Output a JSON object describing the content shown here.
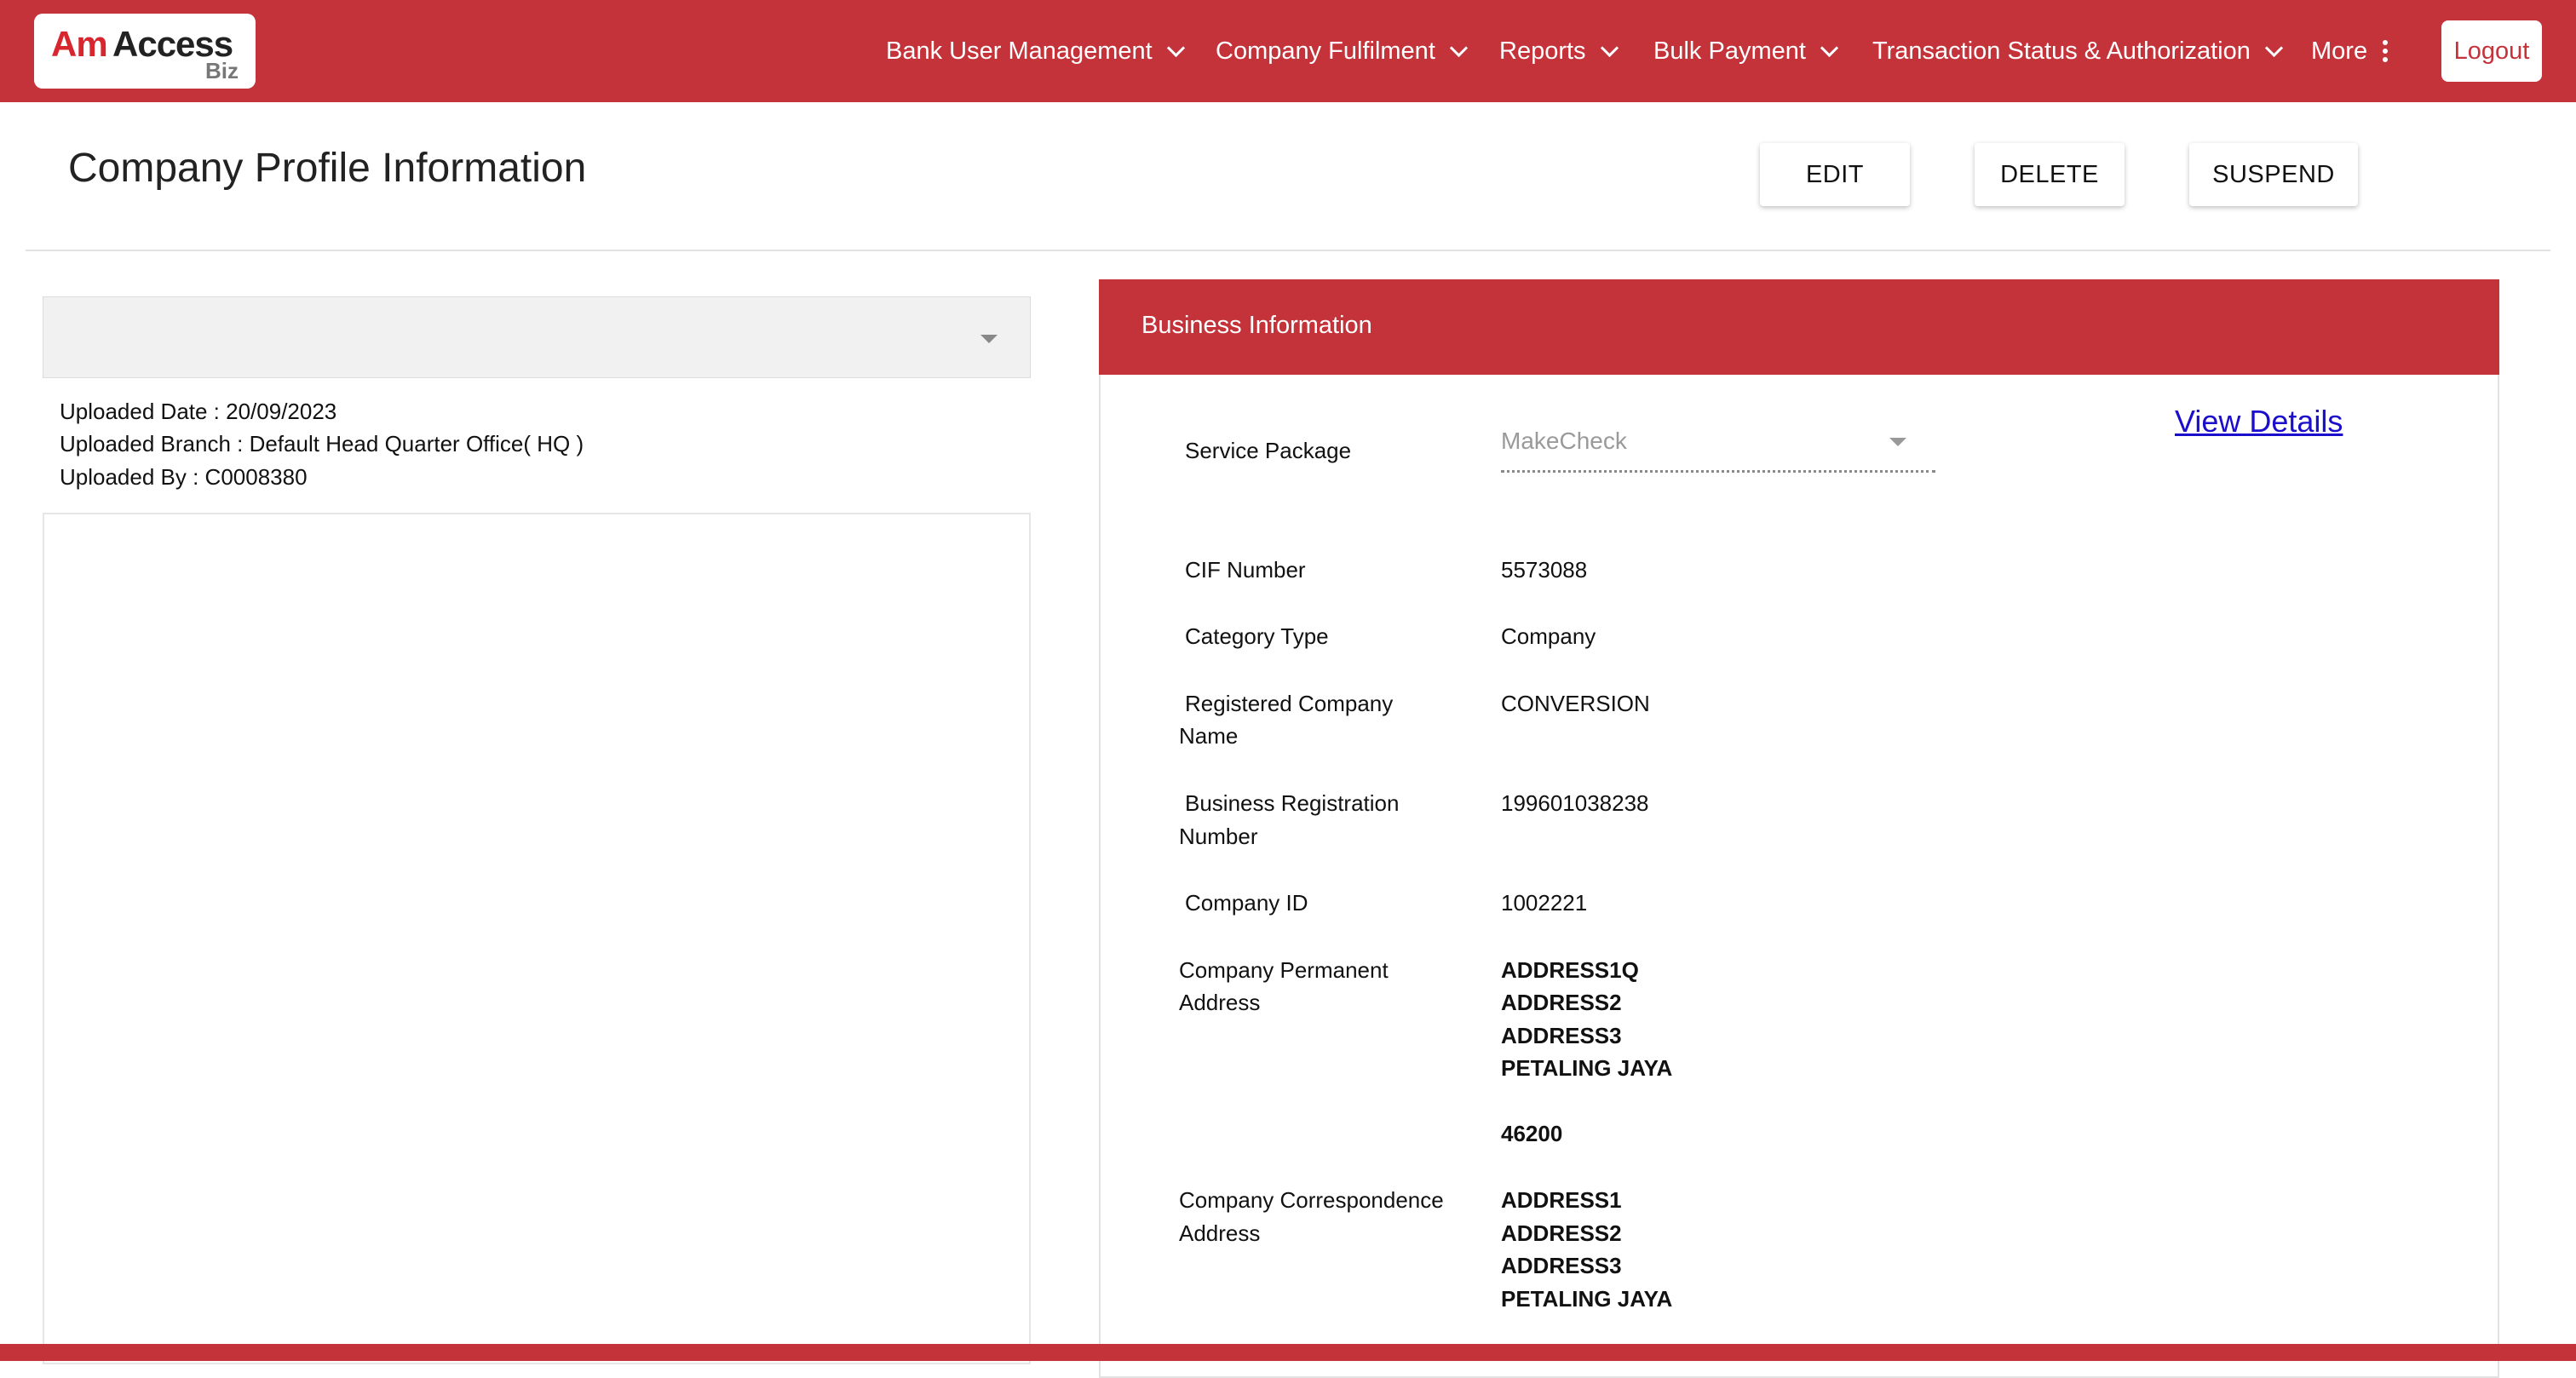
{
  "brand": {
    "logo_am": "Am",
    "logo_access": "Access",
    "logo_biz": "Biz",
    "primary_color": "#c4323a",
    "link_color": "#1a0dcc"
  },
  "nav": {
    "items": [
      {
        "label": "Bank User Management",
        "icon": "chevron-down-icon"
      },
      {
        "label": "Company Fulfilment",
        "icon": "chevron-down-icon"
      },
      {
        "label": "Reports",
        "icon": "chevron-down-icon"
      },
      {
        "label": "Bulk Payment",
        "icon": "chevron-down-icon"
      },
      {
        "label": "Transaction Status & Authorization",
        "icon": "chevron-down-icon"
      },
      {
        "label": "More",
        "icon": "more-vertical-icon"
      }
    ],
    "logout_label": "Logout"
  },
  "header": {
    "title": "Company Profile Information",
    "actions": {
      "edit": "EDIT",
      "delete": "DELETE",
      "suspend": "SUSPEND"
    }
  },
  "document": {
    "selected": "",
    "uploaded_date": "Uploaded Date : 20/09/2023",
    "uploaded_branch": "Uploaded Branch : Default Head Quarter Office( HQ )",
    "uploaded_by": "Uploaded By : C0008380"
  },
  "business": {
    "section_title": "Business Information",
    "view_details": "View Details",
    "service_package": {
      "label": "Service Package",
      "value": "MakeCheck"
    },
    "cif": {
      "label": "CIF Number",
      "value": "5573088"
    },
    "category": {
      "label": "Category Type",
      "value": "Company"
    },
    "company_name": {
      "label_line1": "Registered Company",
      "label_line2": "Name",
      "value": "CONVERSION"
    },
    "brn": {
      "label_line1": "Business Registration",
      "label_line2": "Number",
      "value": "199601038238"
    },
    "company_id": {
      "label": "Company ID",
      "value": "1002221"
    },
    "permanent_address": {
      "label_line1": "Company Permanent",
      "label_line2": "Address",
      "lines": [
        "ADDRESS1Q",
        "ADDRESS2",
        "ADDRESS3",
        "PETALING JAYA"
      ],
      "postcode": "46200"
    },
    "correspondence_address": {
      "label_line1": "Company Correspondence",
      "label_line2": "Address",
      "lines": [
        "ADDRESS1",
        "ADDRESS2",
        "ADDRESS3",
        "PETALING JAYA"
      ]
    }
  }
}
